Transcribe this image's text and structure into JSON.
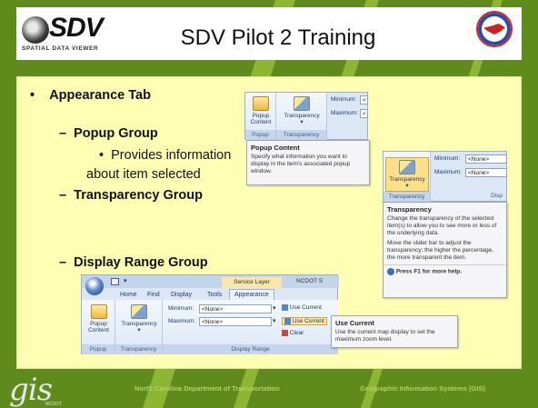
{
  "logo": {
    "brand": "SDV",
    "subtitle": "SPATIAL DATA VIEWER",
    "tiny_text": "NCDOT"
  },
  "slide_title": "SDV Pilot 2 Training",
  "bullets": {
    "appearance_tab": "Appearance Tab",
    "popup_group": "Popup Group",
    "provides_1": "Provides information",
    "provides_2": "about item selected",
    "transparency_group": "Transparency Group",
    "display_range_group": "Display Range Group",
    "bullet_char": "•",
    "dash_char": "–"
  },
  "shot1": {
    "popup_btn": "Popup",
    "popup_btn2": "Content",
    "transparency_btn": "Transparency",
    "minimum_label": "Minimum:",
    "maximum_label": "Maximum:",
    "min_value": "<",
    "max_value": "<",
    "group_popup": "Popup",
    "group_transparency": "Transparency",
    "tip_title": "Popup Content",
    "tip_body": "Specify what information you want to display in the item's associated popup window."
  },
  "shot2": {
    "transparency_btn": "Transparency",
    "minimum_label": "Minimum:",
    "maximum_label": "Maximum:",
    "min_value": "<None>",
    "max_value": "<None>",
    "group_transparency": "Transparency",
    "group_disp": "Disp",
    "tip_title": "Transparency",
    "tip_body_1": "Change the transparency of the selected item(s) to allow you to see more or less of the underlying data.",
    "tip_body_2": "Move the slider bar to adjust the transparency; the higher the percentage, the more transparent the item.",
    "help": "Press F1 for more help."
  },
  "shot3": {
    "context_tab": "Service Layer",
    "app_name": "NCDOT S",
    "tabs": [
      "Home",
      "Find",
      "Display",
      "Tools",
      "Appearance"
    ],
    "popup_btn": "Popup",
    "popup_btn2": "Content",
    "transparency_btn": "Transparency",
    "minimum_label": "Minimum:",
    "maximum_label": "Maximum:",
    "min_value": "<None>",
    "max_value": "<None>",
    "use_current_1": "Use Current",
    "use_current_2": "Use Current",
    "clear": "Clear",
    "group_popup": "Popup",
    "group_transparency": "Transparency",
    "group_display_range": "Display Range",
    "tip_title": "Use Current",
    "tip_body": "Use the current map display to set the maximum zoom level."
  },
  "footer": {
    "gis_logo": "gis",
    "gis_sub": "NCDOT",
    "left_text": "North Carolina Department of Transportation",
    "right_text": "Geographic Information Systems (GIS)"
  },
  "colors": {
    "background": "#5f8a1c",
    "panel": "#ffffb4",
    "title_bar": "#ffffff",
    "footer_text": "#b5cf6b"
  }
}
